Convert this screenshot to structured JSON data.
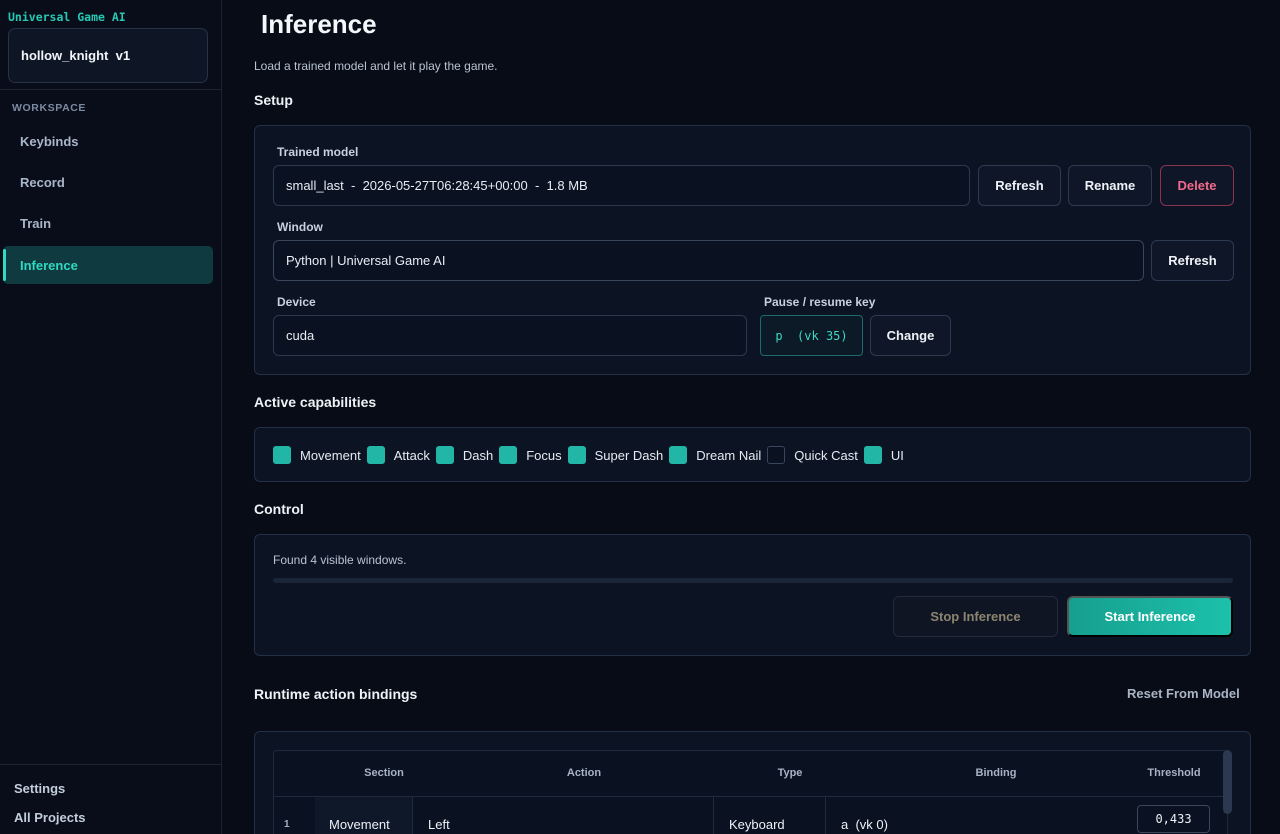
{
  "sidebar": {
    "brand": "Universal Game AI",
    "project": "hollow_knight  v1",
    "workspace_label": "WORKSPACE",
    "items": [
      {
        "label": "Keybinds"
      },
      {
        "label": "Record"
      },
      {
        "label": "Train"
      },
      {
        "label": "Inference",
        "active": true
      }
    ],
    "settings": "Settings",
    "all_projects": "All Projects"
  },
  "page": {
    "title": "Inference",
    "subtitle": "Load a trained model and let it play the game."
  },
  "setup": {
    "title": "Setup",
    "model_label": "Trained model",
    "model_value": "small_last  -  2026-05-27T06:28:45+00:00  -  1.8 MB",
    "refresh_label": "Refresh",
    "rename_label": "Rename",
    "delete_label": "Delete",
    "window_label": "Window",
    "window_value": "Python | Universal Game AI",
    "window_refresh_label": "Refresh",
    "device_label": "Device",
    "device_value": "cuda",
    "pause_label": "Pause / resume key",
    "pause_key": "p  (vk 35)",
    "change_label": "Change"
  },
  "capabilities": {
    "title": "Active capabilities",
    "items": [
      {
        "label": "Movement",
        "checked": true
      },
      {
        "label": "Attack",
        "checked": true
      },
      {
        "label": "Dash",
        "checked": true
      },
      {
        "label": "Focus",
        "checked": true
      },
      {
        "label": "Super Dash",
        "checked": true
      },
      {
        "label": "Dream Nail",
        "checked": true
      },
      {
        "label": "Quick Cast",
        "checked": false
      },
      {
        "label": "UI",
        "checked": true
      }
    ]
  },
  "control": {
    "title": "Control",
    "status": "Found 4 visible windows.",
    "progress": 0,
    "stop_label": "Stop Inference",
    "start_label": "Start Inference"
  },
  "bindings": {
    "title": "Runtime action bindings",
    "reset_label": "Reset From Model",
    "columns": [
      "Section",
      "Action",
      "Type",
      "Binding",
      "Threshold"
    ],
    "rows": [
      {
        "num": "1",
        "section": "Movement",
        "action": "Left",
        "type": "Keyboard",
        "binding": "a  (vk 0)",
        "threshold": "0,433"
      }
    ]
  },
  "colors": {
    "accent": "#2fd9c2",
    "danger": "#f26a8d",
    "background": "#070c17"
  }
}
